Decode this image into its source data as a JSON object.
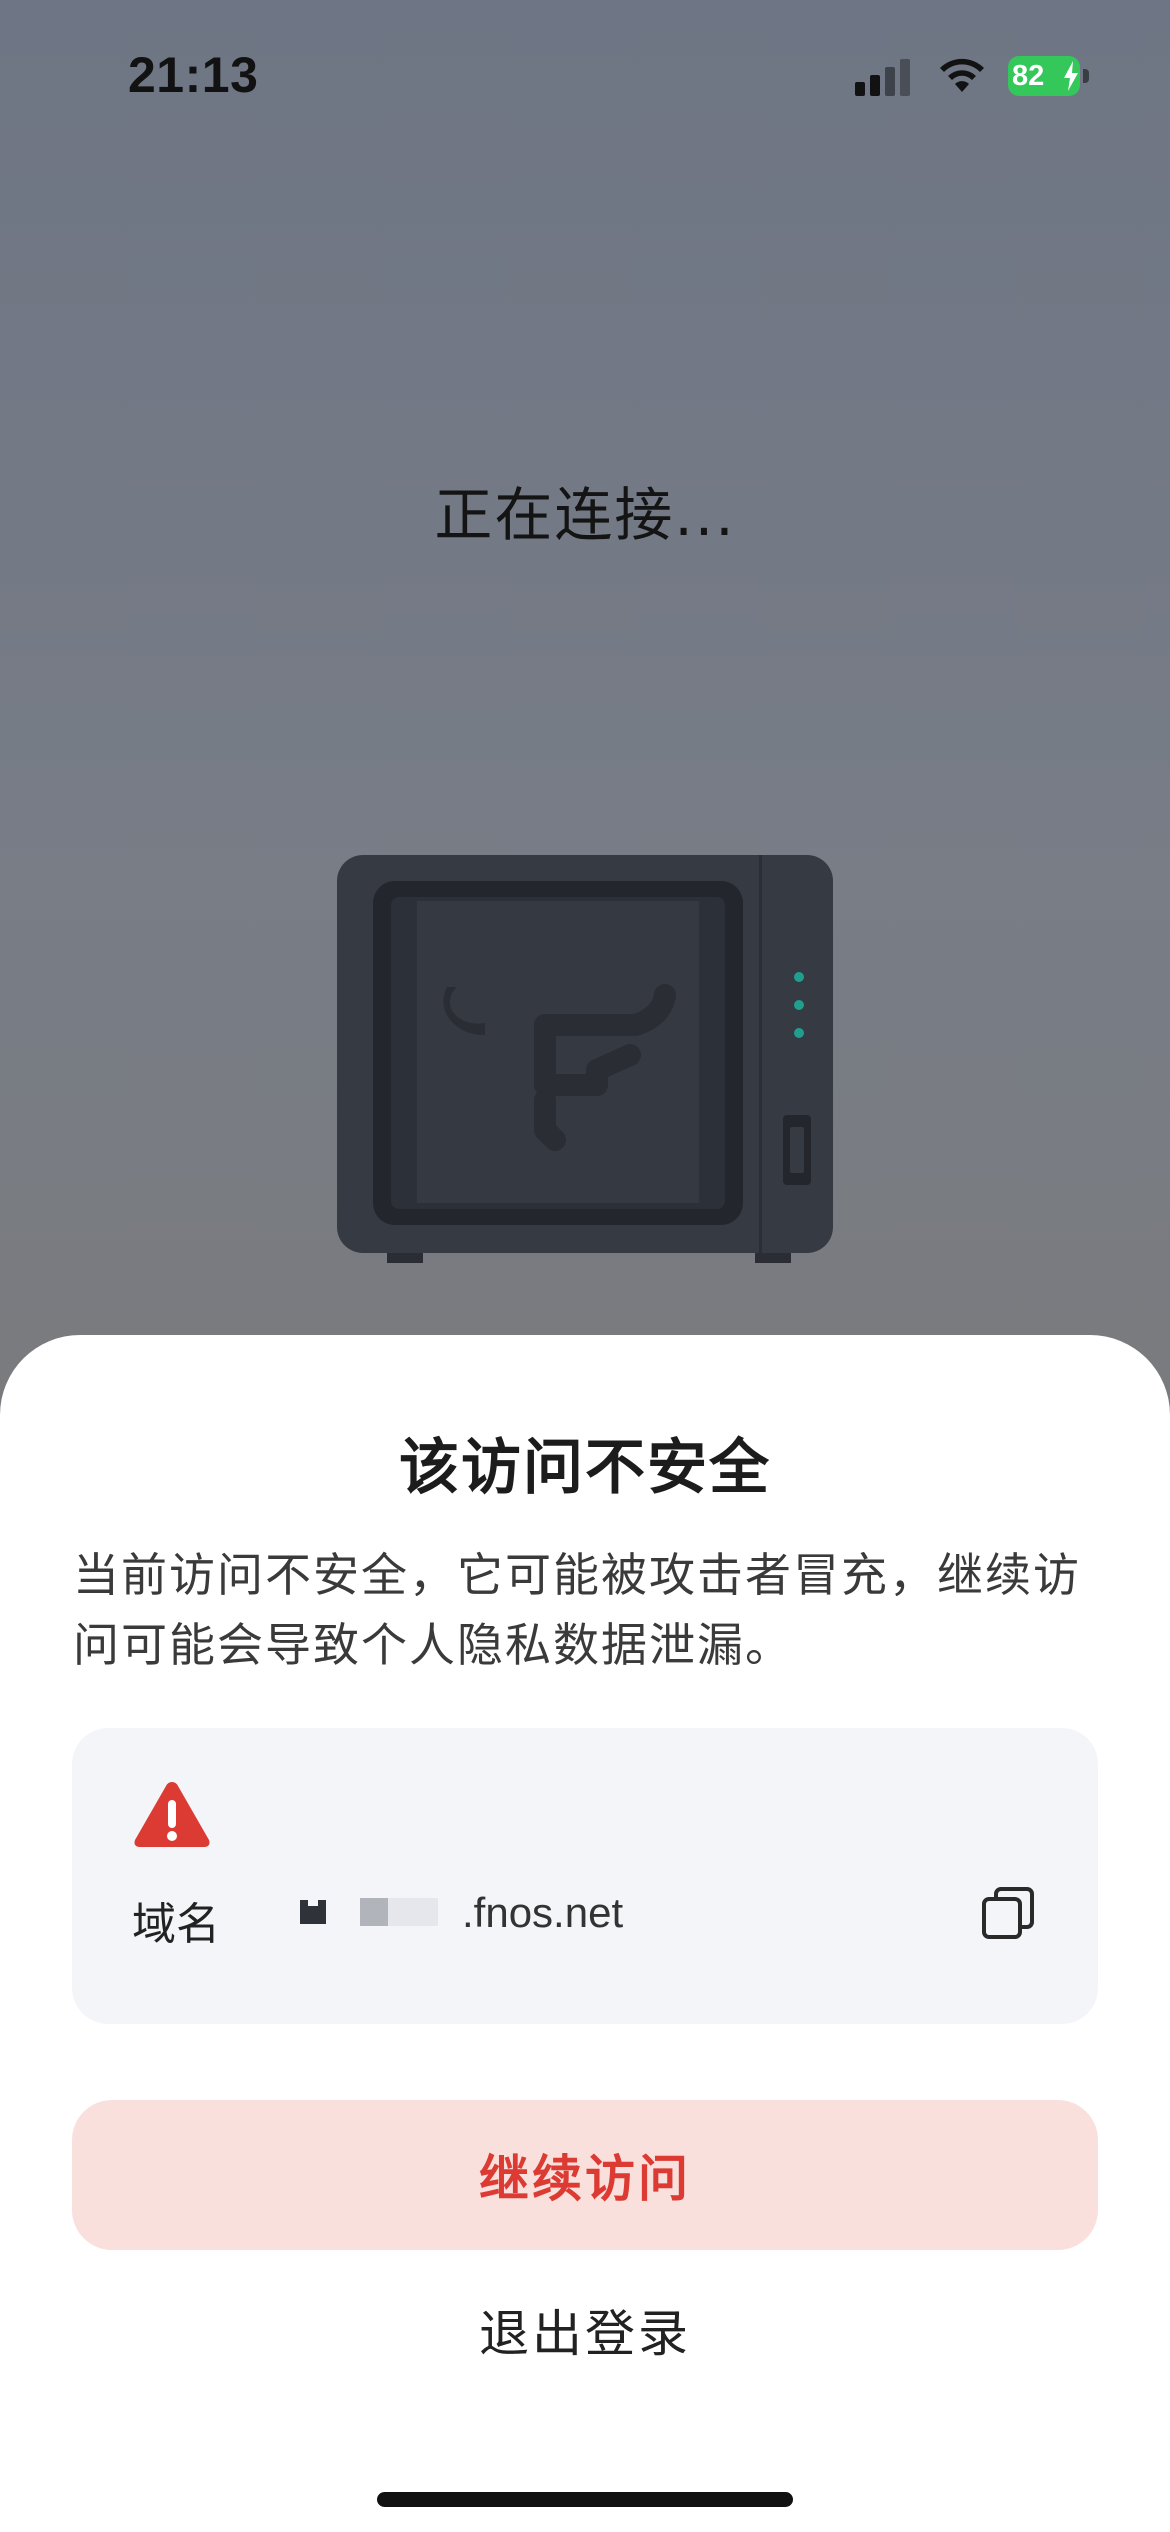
{
  "status_bar": {
    "time": "21:13",
    "battery_level": "82",
    "icons": [
      "signal-icon",
      "wifi-icon",
      "battery-icon",
      "charging-bolt-icon"
    ]
  },
  "background": {
    "connecting_text": "正在连接..."
  },
  "illustration": {
    "name": "nas-device-illustration",
    "accent_color": "#1fa08e"
  },
  "dialog": {
    "title": "该访问不安全",
    "description": "当前访问不安全，它可能被攻击者冒充，继续访问可能会导致个人隐私数据泄漏。",
    "warning_icon": "warning-triangle-icon",
    "domain_label": "域名",
    "domain_value": ".fnos.net",
    "copy_icon": "copy-icon",
    "continue_label": "继续访问",
    "logout_label": "退出登录"
  },
  "colors": {
    "danger": "#dc3b33",
    "danger_bg": "#f9e0dd",
    "battery": "#34c759",
    "card_bg": "#f4f5f9"
  }
}
